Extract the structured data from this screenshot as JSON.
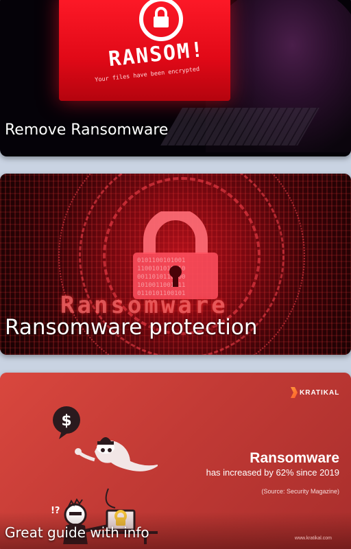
{
  "cards": [
    {
      "title": "Remove Ransomware",
      "image": {
        "ransom_heading": "RANSOM!",
        "ransom_subtext": "Your files have been encrypted"
      }
    },
    {
      "title": "Ransomware protection",
      "image": {
        "overlay_word": "Ransomware"
      }
    },
    {
      "title": "Great guide with info",
      "image": {
        "brand": "KRATIKAL",
        "headline": "Ransomware",
        "stat": "has increased by 62% since 2019",
        "source": "(Source: Security Magazine)",
        "site": "www.kratikal.com"
      }
    }
  ],
  "colors": {
    "page_background": "#c9d3e2",
    "ransom_red": "#e10917",
    "card3_red": "#c63a35",
    "brand_orange": "#ff7a30"
  }
}
